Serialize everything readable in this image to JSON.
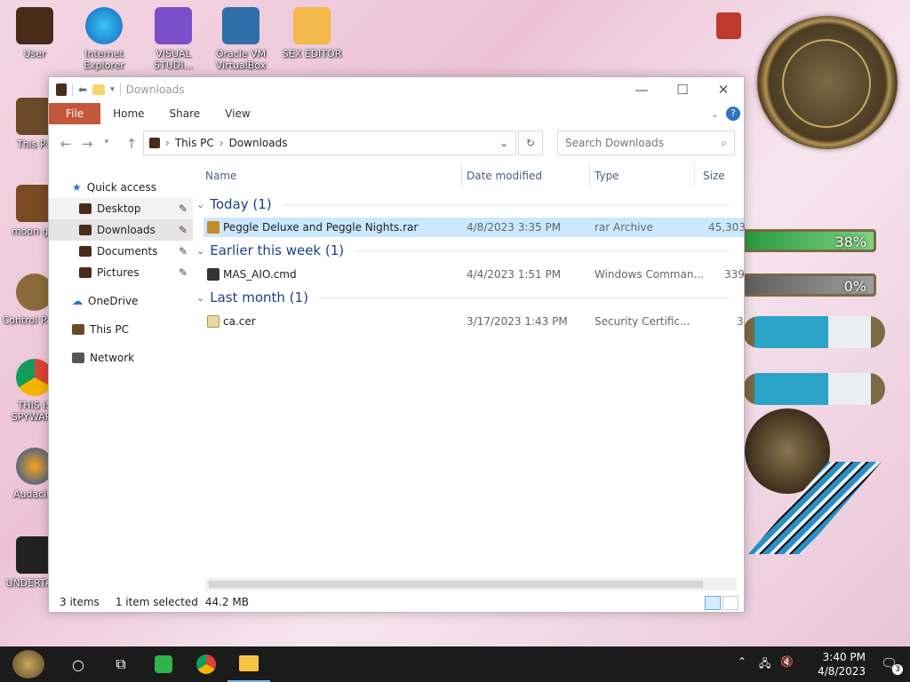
{
  "desktop": {
    "icons": [
      {
        "label": "User"
      },
      {
        "label": "Internet Explorer"
      },
      {
        "label": "VISUAL STUDI..."
      },
      {
        "label": "Oracle VM VirtualBox"
      },
      {
        "label": "SEX EDITOR"
      },
      {
        "label": "This PC"
      },
      {
        "label": "moon girl"
      },
      {
        "label": "Control Panel"
      },
      {
        "label": "THIS IS SPYWARE"
      },
      {
        "label": "Audacity"
      },
      {
        "label": "UNDERTALE"
      }
    ],
    "gauges": [
      {
        "label": "38%",
        "value": 0.38
      },
      {
        "label": "0%",
        "value": 0
      }
    ]
  },
  "window": {
    "title": "Downloads",
    "ribbon": {
      "file": "File",
      "home": "Home",
      "share": "Share",
      "view": "View"
    },
    "breadcrumb": [
      "This PC",
      "Downloads"
    ],
    "search_placeholder": "Search Downloads",
    "nav": {
      "quick_access": "Quick access",
      "items": [
        "Desktop",
        "Downloads",
        "Documents",
        "Pictures"
      ],
      "onedrive": "OneDrive",
      "this_pc": "This PC",
      "network": "Network"
    },
    "columns": {
      "name": "Name",
      "date": "Date modified",
      "type": "Type",
      "size": "Size"
    },
    "groups": [
      {
        "label": "Today (1)",
        "file": {
          "name": "Peggle Deluxe and Peggle Nights.rar",
          "date": "4/8/2023 3:35 PM",
          "type": "rar Archive",
          "size": "45,303"
        }
      },
      {
        "label": "Earlier this week (1)",
        "file": {
          "name": "MAS_AIO.cmd",
          "date": "4/4/2023 1:51 PM",
          "type": "Windows Comman...",
          "size": "339"
        }
      },
      {
        "label": "Last month (1)",
        "file": {
          "name": "ca.cer",
          "date": "3/17/2023 1:43 PM",
          "type": "Security Certific...",
          "size": "3"
        }
      }
    ],
    "status": {
      "count": "3 items",
      "selected": "1 item selected",
      "size": "44.2 MB"
    }
  },
  "taskbar": {
    "time": "3:40 PM",
    "date": "4/8/2023",
    "notif": "3"
  },
  "colors": {
    "file_tab": "#c4573a",
    "selection": "#cce8ff",
    "group_text": "#1e3f8b"
  }
}
